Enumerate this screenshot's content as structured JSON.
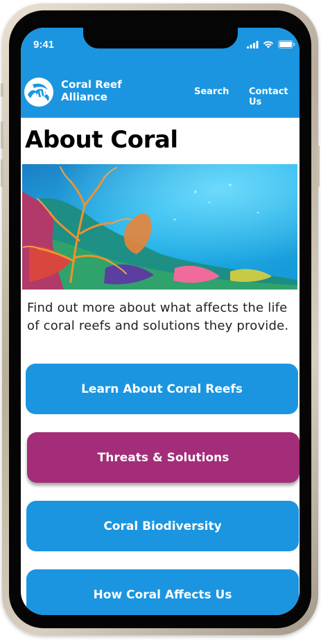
{
  "status_bar": {
    "time": "9:41"
  },
  "nav": {
    "brand_line1": "Coral Reef",
    "brand_line2": "Alliance",
    "links": [
      "Search",
      "Contact Us"
    ]
  },
  "page": {
    "title": "About Coral",
    "intro": "Find out more about what affects the life of coral reefs and solutions they provide."
  },
  "buttons": [
    "Learn About Coral Reefs",
    "Threats & Solutions",
    "Coral Biodiversity",
    "How Coral Affects Us"
  ],
  "colors": {
    "primary_blue": "#1b95e0",
    "accent_purple": "#a32d78",
    "text": "#000000"
  },
  "icons": [
    "coral-reef-alliance-logo",
    "signal-icon",
    "wifi-icon",
    "battery-icon"
  ]
}
